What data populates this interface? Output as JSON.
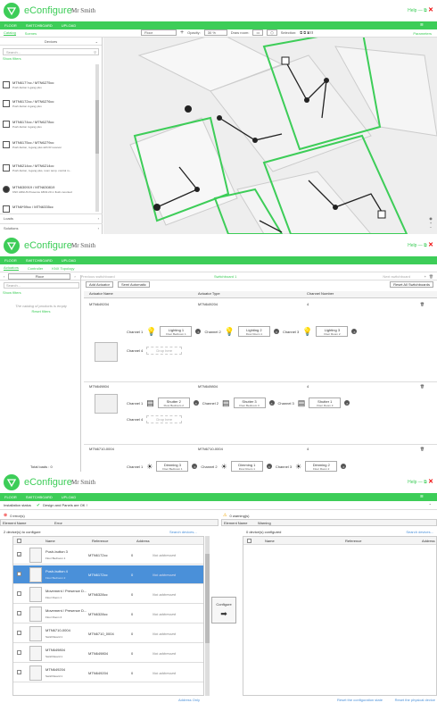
{
  "app": {
    "name": "eConfigure",
    "user": "Mr Smith",
    "help": "Help",
    "min": "—",
    "max": "⧉",
    "close": "✕"
  },
  "nav": {
    "floor": "FLOOR",
    "switchboard": "SWITCHBOARD",
    "upload": "UPLOAD"
  },
  "p1": {
    "tab_catalog": "Catalog",
    "tab_scenes": "Scenes",
    "parameters": "Parameters",
    "floor_select": "Floor",
    "opacity_label": "Opacity:",
    "opacity_value": "30 %",
    "draw_room": "Draw room:",
    "selection": "Selection:",
    "devices": "Devices",
    "search_placeholder": "Search...",
    "show_filters": "Show filters",
    "items": [
      {
        "title": "MTN617?cc / MTN6275cc",
        "desc": "Push-button 1-gang plus"
      },
      {
        "title": "MTN6172cc / MTN6276cc",
        "desc": "Push-button 2-gang plus"
      },
      {
        "title": "MTN6174cc / MTN6278cc",
        "desc": "Push-button 4-gang plus"
      },
      {
        "title": "MTN6175cc / MTN6279cc",
        "desc": "Push-button, 4-gang plus with IR receiver"
      },
      {
        "title": "MTN6214cc / MTN6214cc",
        "desc": "Push-button, 4-gang plus, room temp. control m..."
      },
      {
        "title": "MTN630919 / MTN630819",
        "desc": "KNX ARGUS Presence 180/2.20 m flush-mounted"
      },
      {
        "title": "MTN6*59cc / MTN6335cc",
        "desc": ""
      }
    ],
    "loads": "Loads",
    "solutions": "Solutions"
  },
  "p2": {
    "tab_actuators": "Actuators",
    "tab_controller": "Controller",
    "tab_knx": "KNX Topology",
    "floor": "Floor",
    "prev": "Previous switchboard",
    "switchboard": "Switchboard 1",
    "next": "Next switchboard",
    "add_actuator": "Add Actuator",
    "semi_auto": "Semi Automatic",
    "reset_all": "Reset All Switchboards",
    "catalog_empty": "The catalog of products is empty",
    "reset_filters": "Reset filters",
    "col_name": "Actuator Name",
    "col_type": "Actuator Type",
    "col_channel": "Channel Number",
    "total_loads": "Total loads : 0",
    "actuators": [
      {
        "name": "MTN649204",
        "type": "MTN649204",
        "num": "4",
        "channels": [
          {
            "ch": "Channel 1",
            "l1": "Lighting 1",
            "l2": "Floor Bedroom 1"
          },
          {
            "ch": "Channel 2",
            "l1": "Lighting 2",
            "l2": "Floor Room 1"
          },
          {
            "ch": "Channel 3",
            "l1": "Lighting 3",
            "l2": "Floor Room 2"
          }
        ],
        "ch4": "Channel 4",
        "drop": "Drop here"
      },
      {
        "name": "MTN649804",
        "type": "MTN649804",
        "num": "4",
        "channels": [
          {
            "ch": "Channel 1",
            "l1": "Shutter 2",
            "l2": "Floor Bedroom 2"
          },
          {
            "ch": "Channel 2",
            "l1": "Shutter 3",
            "l2": "Floor Bedroom 3"
          },
          {
            "ch": "Channel 3",
            "l1": "Shutter 1",
            "l2": "Floor Room 3"
          }
        ],
        "ch4": "Channel 4",
        "drop": "Drop here"
      },
      {
        "name": "MTN6710-0004",
        "type": "MTN6710-0004",
        "num": "4",
        "channels": [
          {
            "ch": "Channel 1",
            "l1": "Dimming 3",
            "l2": "Floor Bedroom 1"
          },
          {
            "ch": "Channel 2",
            "l1": "Dimming 1",
            "l2": "Floor Room 1"
          },
          {
            "ch": "Channel 3",
            "l1": "Dimming 2",
            "l2": "Floor Room 2"
          }
        ]
      }
    ]
  },
  "p3": {
    "status": "Installation status",
    "ok": "Design and Panels are OK !",
    "errors": "0 error(s)",
    "warnings": "0 warning(s)",
    "err_col1": "Element Name",
    "err_col2": "Error",
    "warn_col1": "Element Name",
    "warn_col2": "Warning",
    "to_configure": "2 device(s) to configure",
    "configured": "0 device(s) configured",
    "search_devices": "Search devices...",
    "col_name": "Name",
    "col_ref": "Reference",
    "col_addr": "Address",
    "configure": "Configure",
    "address_only": "Address Only",
    "reset_config": "Reset the configuration state",
    "reset_phys": "Reset the physical device",
    "rows": [
      {
        "name": "Push-button 3",
        "sub": "Floor Bedroom 1",
        "ref": "MTN6172cc",
        "addr": "0",
        "state": "Not addressed"
      },
      {
        "name": "Push-button 4",
        "sub": "Floor Bedroom 2",
        "ref": "MTN6172cc",
        "addr": "0",
        "state": "Not addressed"
      },
      {
        "name": "Movement / Presence D...",
        "sub": "Floor Room 1",
        "ref": "MTN6328cc",
        "addr": "0",
        "state": "Not addressed"
      },
      {
        "name": "Movement / Presence D...",
        "sub": "Floor Room 2",
        "ref": "MTN6328cc",
        "addr": "0",
        "state": "Not addressed"
      },
      {
        "name": "MTN6710-0004",
        "sub": "Switchboard 1",
        "ref": "MTN6710_0004",
        "addr": "0",
        "state": "Not addressed"
      },
      {
        "name": "MTN649804",
        "sub": "Switchboard 1",
        "ref": "MTN649804",
        "addr": "0",
        "state": "Not addressed"
      },
      {
        "name": "MTN649204",
        "sub": "Switchboard 1",
        "ref": "MTN649204",
        "addr": "0",
        "state": "Not addressed"
      }
    ]
  }
}
